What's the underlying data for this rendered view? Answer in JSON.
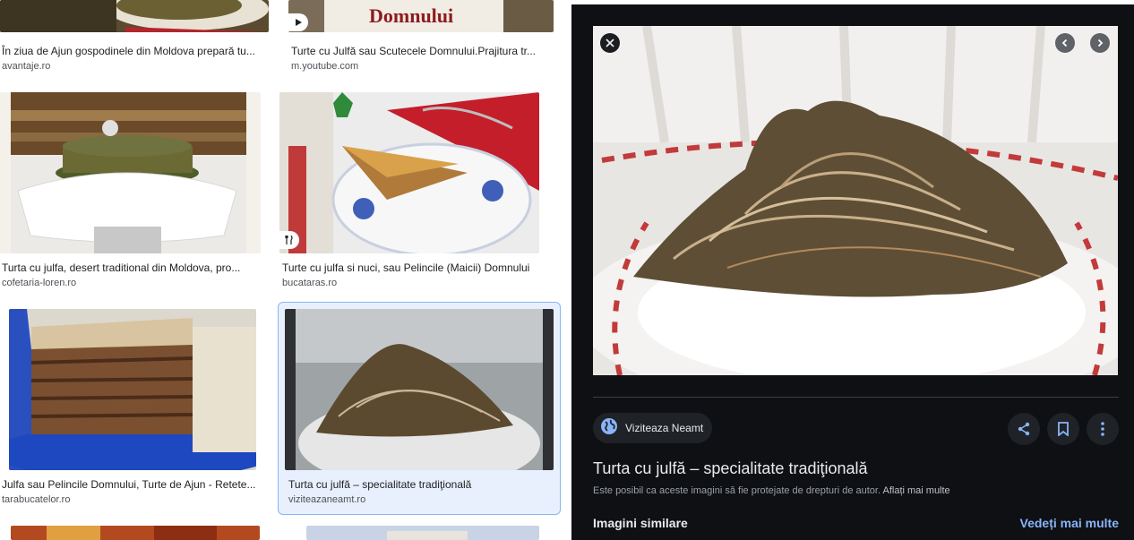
{
  "results": [
    {
      "caption": "În ziua de Ajun gospodinele din Moldova prepară tu...",
      "source": "avantaje.ro"
    },
    {
      "caption": "Turte cu Julfă sau Scutecele Domnului.Prajitura tr...",
      "source": "m.youtube.com",
      "thumb_text": "Domnului"
    },
    {
      "caption": "Turta cu julfa, desert traditional din Moldova, pro...",
      "source": "cofetaria-loren.ro"
    },
    {
      "caption": "Turte cu julfa si nuci, sau Pelincile (Maicii) Domnului",
      "source": "bucataras.ro"
    },
    {
      "caption": "Julfa sau Pelincile Domnului, Turte de Ajun - Retete...",
      "source": "tarabucatelor.ro"
    },
    {
      "caption": "Turta cu julfă – specialitate tradiţională",
      "source": "viziteazaneamt.ro"
    }
  ],
  "preview": {
    "site_name": "Viziteaza Neamt",
    "title": "Turta cu julfă – specialitate tradiţională",
    "copyright_text": "Este posibil ca aceste imagini să fie protejate de drepturi de autor.",
    "learn_more": "Aflați mai multe",
    "similar_label": "Imagini similare",
    "see_more": "Vedeți mai multe"
  },
  "icons": {
    "close": "close-icon",
    "prev": "chevron-left-icon",
    "next": "chevron-right-icon",
    "share": "share-icon",
    "save": "bookmark-icon",
    "more": "more-vert-icon",
    "globe": "globe-icon",
    "video": "play-icon",
    "recipe": "fork-knife-icon"
  },
  "colors": {
    "accent": "#8ab4f8",
    "panel_bg": "#0e1014",
    "selected_bg": "#e8f0fe"
  }
}
